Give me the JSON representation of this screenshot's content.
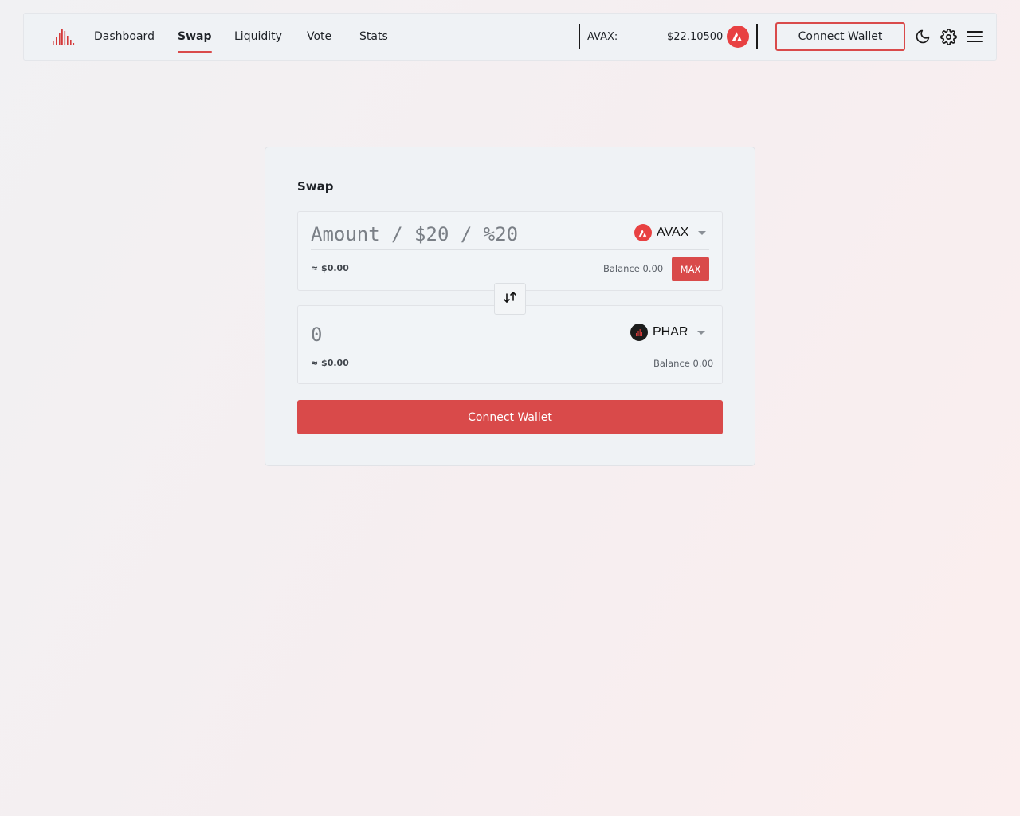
{
  "nav": {
    "items": [
      {
        "label": "Dashboard",
        "active": false
      },
      {
        "label": "Swap",
        "active": true
      },
      {
        "label": "Liquidity",
        "active": false
      },
      {
        "label": "Vote",
        "active": false
      },
      {
        "label": "Stats",
        "active": false
      }
    ],
    "price_label": "AVAX:",
    "price_value": "$22.10500",
    "connect_label": "Connect Wallet",
    "icons": [
      "logo-icon",
      "avax-icon",
      "moon-icon",
      "gear-icon",
      "menu-icon"
    ]
  },
  "swap": {
    "title": "Swap",
    "from": {
      "placeholder": "Amount / $20 / %20",
      "token": "AVAX",
      "usd": "≈ $0.00",
      "balance_label": "Balance",
      "balance_value": "0.00",
      "max_label": "MAX"
    },
    "to": {
      "placeholder": "0",
      "token": "PHAR",
      "usd": "≈ $0.00",
      "balance_label": "Balance",
      "balance_value": "0.00"
    },
    "flip_icon": "swap-arrows-icon",
    "cta_label": "Connect Wallet"
  },
  "colors": {
    "accent": "#d94a4a",
    "avax": "#e84142",
    "phar": "#1c1c1c",
    "panel": "#eff2f5"
  }
}
